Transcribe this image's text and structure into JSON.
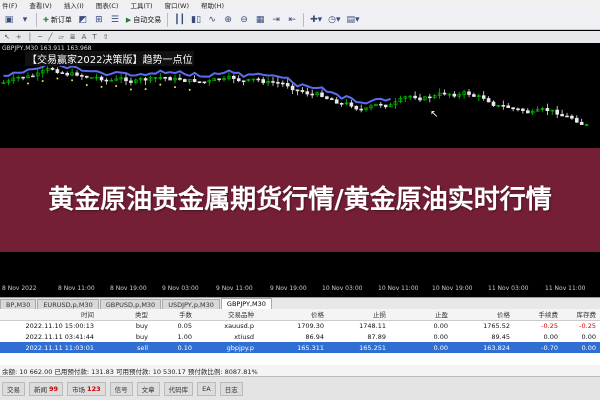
{
  "menu": [
    "件(F)",
    "查看(V)",
    "插入(I)",
    "图表(C)",
    "工具(T)",
    "窗口(W)",
    "帮助(H)"
  ],
  "toolbar": {
    "new_order": "新订单",
    "auto_trading": "自动交易"
  },
  "chart": {
    "symbol_info": "GBPJPY,M30 163.911 163.968",
    "banner": "【交易赢家2022决策版】趋势一点位",
    "x_ticks": [
      "8 Nov 2022",
      "8 Nov 11:00",
      "8 Nov 19:00",
      "9 Nov 03:00",
      "9 Nov 11:00",
      "9 Nov 19:00",
      "10 Nov 03:00",
      "10 Nov 11:00",
      "10 Nov 19:00",
      "11 Nov 03:00",
      "11 Nov 11:00"
    ]
  },
  "headline": "黄金原油贵金属期货行情/黄金原油实时行情",
  "tabs": [
    "BP,M30",
    "EURUSD,p,M30",
    "GBPUSD,p,M30",
    "USDJPY,p,M30",
    "GBPJPY,M30"
  ],
  "active_tab": 4,
  "orders": {
    "columns": [
      "时间",
      "类型",
      "手数",
      "交易品种",
      "价格",
      "止损",
      "止盈",
      "价格",
      "手续费",
      "库存费"
    ],
    "rows": [
      [
        "2022.11.10 15:00:13",
        "buy",
        "0.05",
        "xauusd.p",
        "1709.30",
        "1748.11",
        "0.00",
        "1765.52",
        "-0.25",
        "-0.25"
      ],
      [
        "2022.11.11 03:41:44",
        "buy",
        "1.00",
        "xtiusd",
        "86.94",
        "87.89",
        "0.00",
        "89.45",
        "0.00",
        "0.00"
      ],
      [
        "2022.11.11 11:03:01",
        "sell",
        "0.10",
        "gbpjpy.p",
        "165.311",
        "165.251",
        "0.00",
        "163.824",
        "-0.70",
        "0.00"
      ]
    ],
    "selected_row": 2
  },
  "summary": "余额: 10 662.00  已用预付款: 131.83  可用预付款: 10 530.17  预付款比例: 8087.81%",
  "bottom_tabs": [
    {
      "label": "交易",
      "badge": ""
    },
    {
      "label": "新闻",
      "badge": "99"
    },
    {
      "label": "市场",
      "badge": "123"
    },
    {
      "label": "信号",
      "badge": ""
    },
    {
      "label": "文章",
      "badge": ""
    },
    {
      "label": "代码库",
      "badge": ""
    },
    {
      "label": "EA",
      "badge": ""
    },
    {
      "label": "日志",
      "badge": ""
    }
  ],
  "colors": {
    "overlay": "#962846",
    "bull_candle": "#00c800",
    "bear_candle": "#e8e8e8",
    "trend_line": "#5a6cf0",
    "trend_dots": "#e8e84a"
  }
}
